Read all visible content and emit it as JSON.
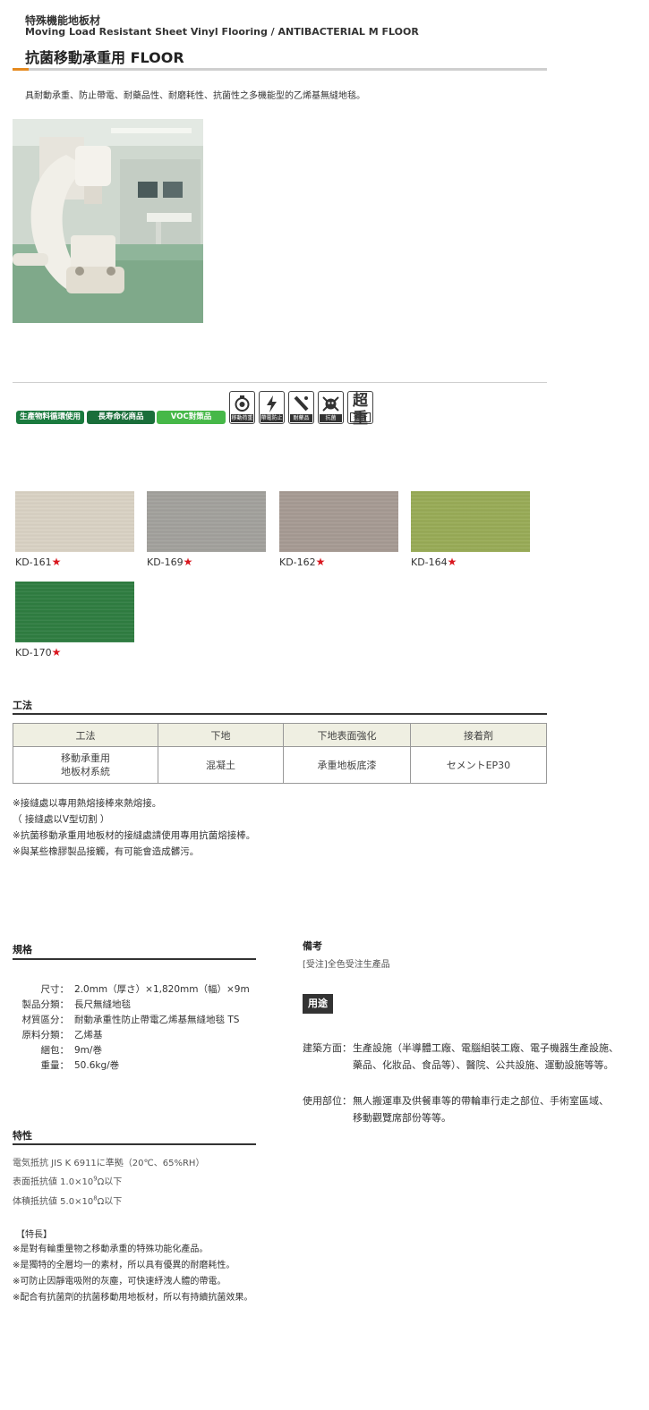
{
  "header": {
    "category": "特殊機能地板材",
    "subtitle": "Moving Load Resistant Sheet Vinyl Flooring / ANTIBACTERIAL M FLOOR",
    "title": "抗菌移動承重用 FLOOR",
    "description": "具耐動承重、防止帶電、耐藥品性、耐磨耗性、抗菌性之多機能型的乙烯基無縫地毯。"
  },
  "badges": [
    "生產物料循環使用",
    "長寿命化商品",
    "VOC對策品"
  ],
  "feature_icons": [
    {
      "icon": "caster-wheel-icon",
      "label": "移動荷重"
    },
    {
      "icon": "lightning-icon",
      "label": "帶電防止"
    },
    {
      "icon": "chemical-icon",
      "label": "耐藥品"
    },
    {
      "icon": "bacteria-icon",
      "label": "抗菌"
    },
    {
      "icon": "super-walk-icon",
      "top": "超重",
      "label": "歩行"
    }
  ],
  "colors": {
    "accent": "#e58a1f",
    "star": "#d9171f",
    "badge_dark": "#1a7a3e",
    "badge_light": "#46b848"
  },
  "swatches": [
    {
      "code": "KD-161",
      "color": "#d9d2c4",
      "star": "★"
    },
    {
      "code": "KD-169",
      "color": "#a2a19c",
      "star": "★"
    },
    {
      "code": "KD-162",
      "color": "#a69a93",
      "star": "★"
    },
    {
      "code": "KD-164",
      "color": "#98ab56",
      "star": "★"
    },
    {
      "code": "KD-170",
      "color": "#2f7d41",
      "star": "★"
    }
  ],
  "method": {
    "section_title": "工法",
    "headers": [
      "工法",
      "下地",
      "下地表面強化",
      "接着剤"
    ],
    "row": {
      "method_line1": "移動承重用",
      "method_line2": "地板材系統",
      "base": "混凝土",
      "reinforce": "承重地板底漆",
      "adhesive": "セメントEP30"
    },
    "notes": [
      "※接縫處以專用熱熔接棒來熱熔接。",
      "（ 接縫處以V型切割 ）",
      "※抗菌移動承重用地板材的接縫處請使用專用抗菌熔接棒。",
      "※與某些橡膠製品接觸，有可能會造成髒污。"
    ]
  },
  "spec": {
    "section_title": "規格",
    "rows": [
      {
        "label": "尺寸",
        "value": "2.0mm（厚さ）×1,820mm（幅）×9m"
      },
      {
        "label": "製品分類",
        "value": "長尺無縫地毯"
      },
      {
        "label": "材質區分",
        "value": "耐動承重性防止帶電乙烯基無縫地毯 TS"
      },
      {
        "label": "原料分類",
        "value": "乙烯基"
      },
      {
        "label": "綑包",
        "value": "9m/巻"
      },
      {
        "label": "重量",
        "value": "50.6kg/巻"
      }
    ]
  },
  "remarks": {
    "title": "備考",
    "text": "[受注]全色受注生產品"
  },
  "usage": {
    "tag": "用途",
    "building_label": "建築方面：",
    "building_line1": "生產設施（半導體工廠、電腦組裝工廠、電子機器生產設施、",
    "building_line2": "藥品、化妝品、食品等）、醫院、公共設施、運動設施等等。",
    "area_label": "使用部位：",
    "area_line1": "無人搬運車及供餐車等的帶輪車行走之部位、手術室區域、",
    "area_line2": "移動觀覽席部份等等。"
  },
  "characteristics": {
    "section_title": "特性",
    "line1": "電気抵抗 JIS K 6911に準拠（20℃、65%RH）",
    "line2_pre": "表面抵抗値 1.0×10",
    "line2_exp": "9",
    "line2_post": "Ω以下",
    "line3_pre": "体積抵抗値 5.0×10",
    "line3_exp": "8",
    "line3_post": "Ω以下",
    "features_title": "【特長】",
    "features": [
      "※是對有輪重量物之移動承重的特殊功能化產品。",
      "※是獨特的全層均一的素材，所以具有優異的耐磨耗性。",
      "※可防止因靜電吸附的灰塵，可快速紓洩人體的帶電。",
      "※配合有抗菌劑的抗菌移動用地板材，所以有持續抗菌效果。"
    ]
  }
}
